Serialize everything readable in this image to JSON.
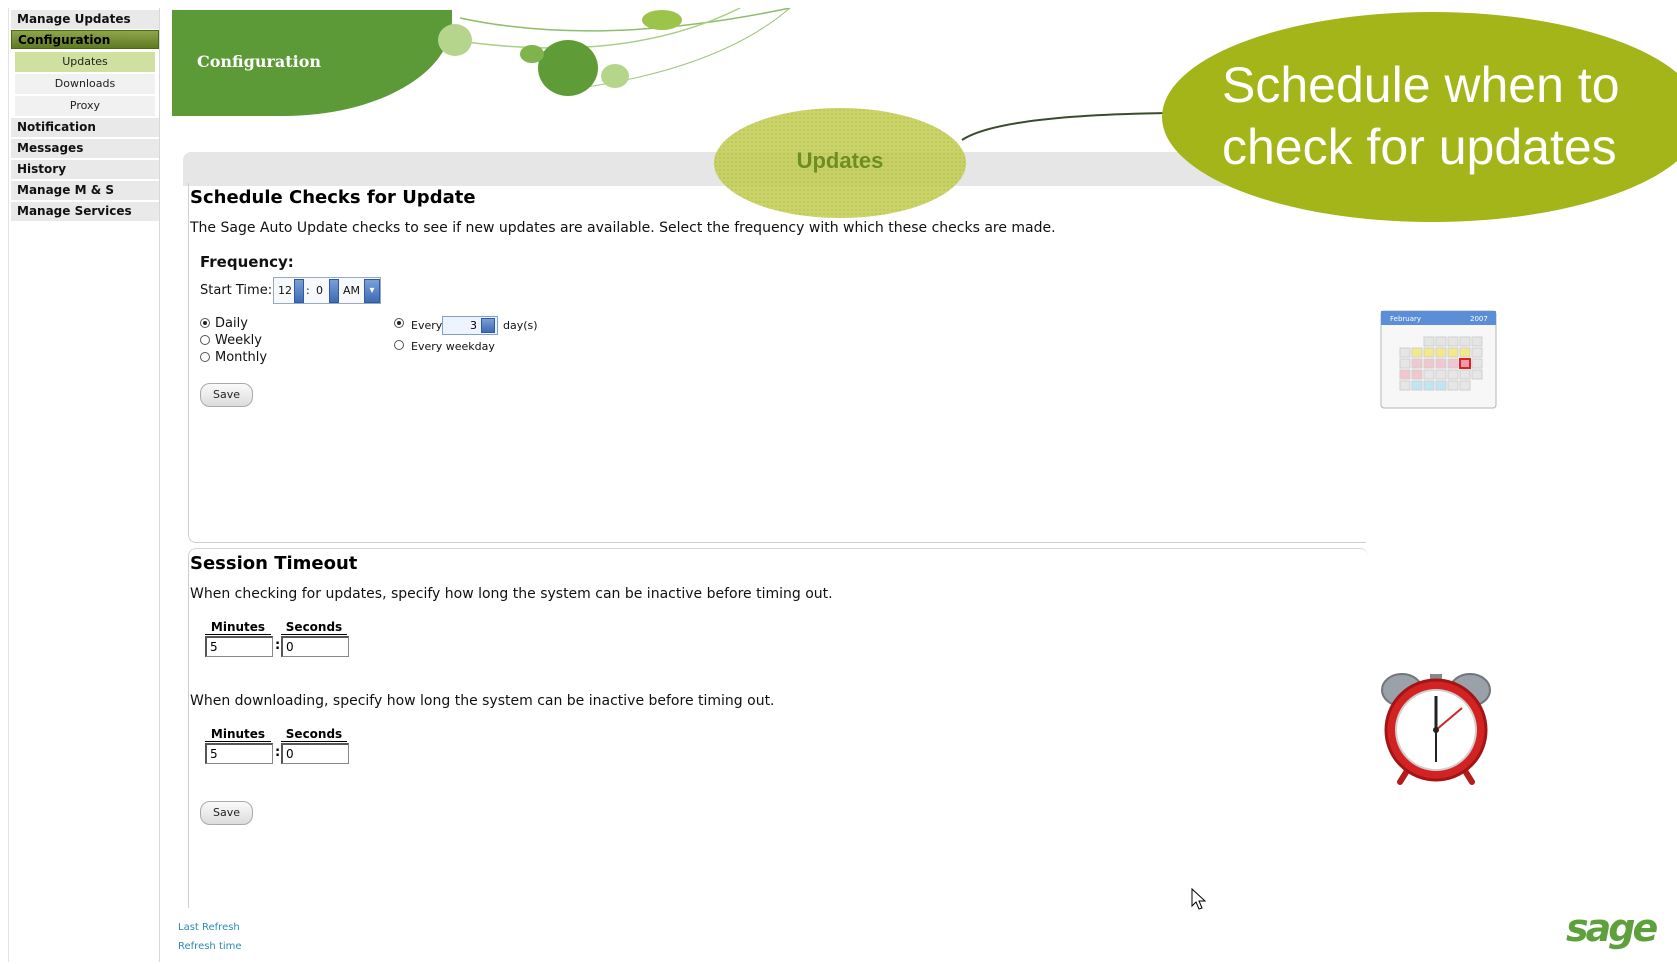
{
  "sidebar": {
    "items": [
      {
        "label": "Manage Updates"
      },
      {
        "label": "Configuration"
      },
      {
        "label": "Notification"
      },
      {
        "label": "Messages"
      },
      {
        "label": "History"
      },
      {
        "label": "Manage M & S"
      },
      {
        "label": "Manage Services"
      }
    ],
    "sub_items": [
      {
        "label": "Updates"
      },
      {
        "label": "Downloads"
      },
      {
        "label": "Proxy"
      }
    ],
    "footer": {
      "last_refresh": "Last Refresh",
      "refresh_time": "Refresh time"
    }
  },
  "header": {
    "title": "Configuration"
  },
  "callout": {
    "line1": "Schedule when to",
    "line2": "check for updates"
  },
  "tab": {
    "label": "Updates"
  },
  "schedule": {
    "title": "Schedule Checks for Update",
    "description": "The Sage Auto Update checks to see if new updates are available. Select the frequency with which these checks are made.",
    "frequency_label": "Frequency:",
    "start_time_label": "Start Time:",
    "hour": "12",
    "minute": "0",
    "separator": ":",
    "ampm": "AM",
    "options": [
      {
        "label": "Daily",
        "selected": true
      },
      {
        "label": "Weekly",
        "selected": false
      },
      {
        "label": "Monthly",
        "selected": false
      }
    ],
    "every_label": "Every",
    "every_value": "3",
    "days_label": "day(s)",
    "every_weekday_label": "Every weekday",
    "save_label": "Save"
  },
  "timeout": {
    "title": "Session Timeout",
    "check_desc": "When checking for updates, specify how long the system can be inactive before timing out.",
    "download_desc": "When downloading, specify how long the system can be inactive before timing out.",
    "minutes_label": "Minutes",
    "seconds_label": "Seconds",
    "check_minutes": "5",
    "check_seconds": "0",
    "download_minutes": "5",
    "download_seconds": "0",
    "save_label": "Save"
  },
  "calendar_icon": {
    "month": "February",
    "year": "2007"
  },
  "brand": {
    "logo_text": "sage",
    "accent": "#a4b51a",
    "header_green": "#5b9a36"
  }
}
